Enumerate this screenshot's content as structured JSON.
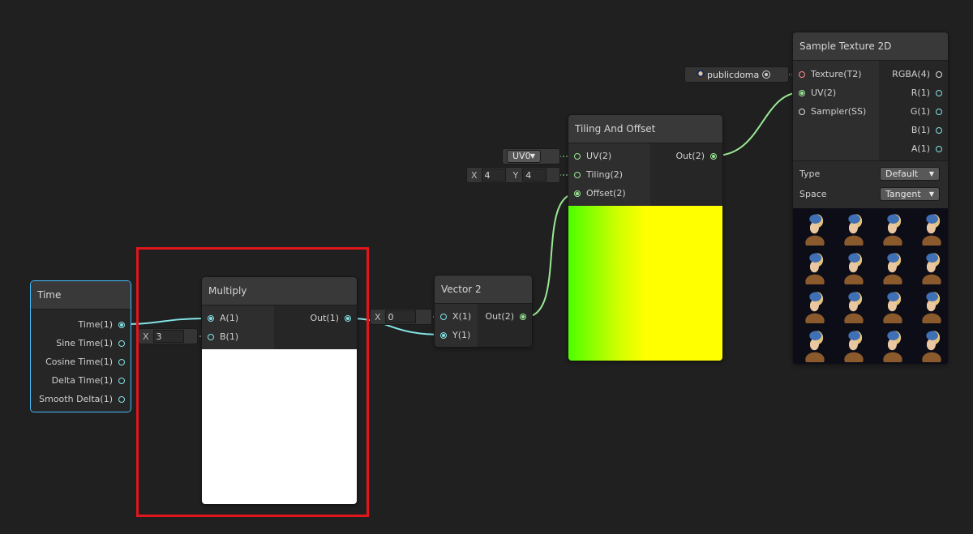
{
  "colors": {
    "background": "#202020",
    "wire_float": "#84e4e7",
    "wire_vector2": "#9ae895",
    "selection": "#44c0ff",
    "highlight_box": "#e0161c",
    "preview_gradient_start": "#4dff00",
    "preview_gradient_end": "#ffff00"
  },
  "time_node": {
    "title": "Time",
    "outputs": [
      "Time(1)",
      "Sine Time(1)",
      "Cosine Time(1)",
      "Delta Time(1)",
      "Smooth Delta(1)"
    ]
  },
  "multiply_node": {
    "title": "Multiply",
    "inputs": [
      "A(1)",
      "B(1)"
    ],
    "output": "Out(1)",
    "b_field": {
      "axis": "X",
      "value": "3"
    }
  },
  "vector2_node": {
    "title": "Vector 2",
    "inputs": [
      "X(1)",
      "Y(1)"
    ],
    "output": "Out(2)",
    "x_field": {
      "axis": "X",
      "value": "0"
    }
  },
  "tiling_node": {
    "title": "Tiling And Offset",
    "inputs": [
      "UV(2)",
      "Tiling(2)",
      "Offset(2)"
    ],
    "output": "Out(2)",
    "uv_dropdown": "UV0",
    "tiling_field": {
      "x_axis": "X",
      "x_value": "4",
      "y_axis": "Y",
      "y_value": "4"
    }
  },
  "sample_texture_node": {
    "title": "Sample Texture 2D",
    "inputs": [
      "Texture(T2)",
      "UV(2)",
      "Sampler(SS)"
    ],
    "outputs": [
      "RGBA(4)",
      "R(1)",
      "G(1)",
      "B(1)",
      "A(1)"
    ],
    "texture_field": "publicdoma",
    "type_label": "Type",
    "type_value": "Default",
    "space_label": "Space",
    "space_value": "Tangent",
    "preview_description": "tiled-portrait-image"
  }
}
